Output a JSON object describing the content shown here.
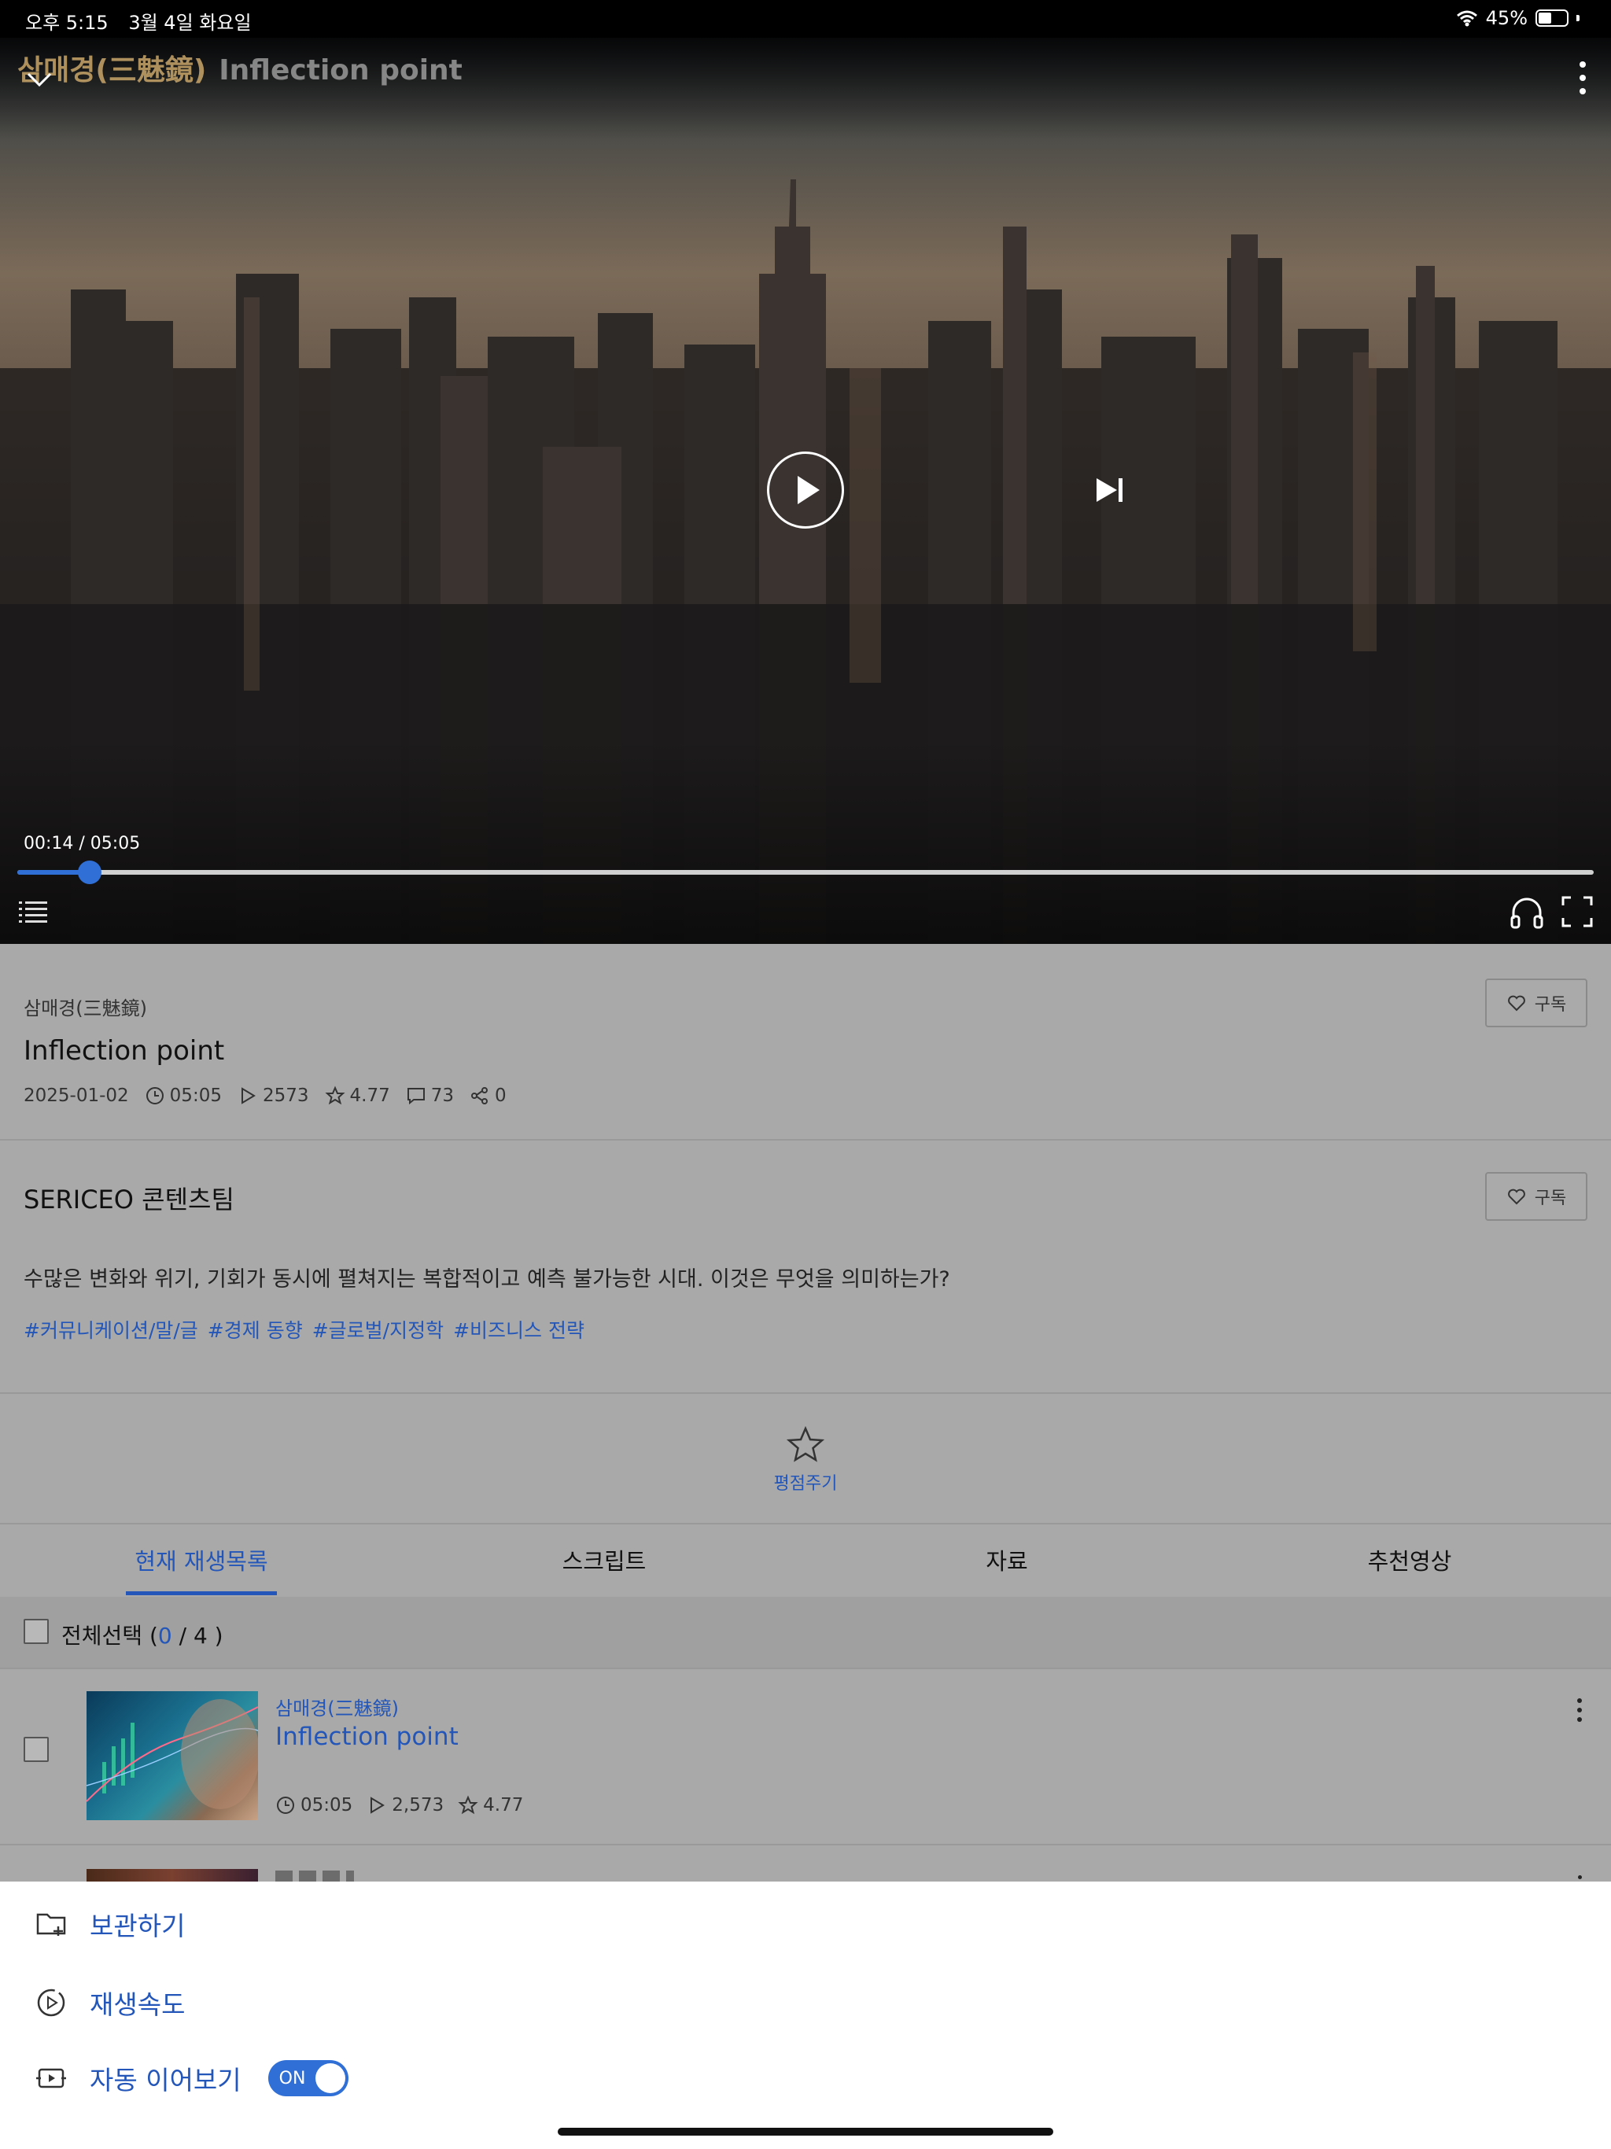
{
  "status_bar": {
    "time": "오후 5:15",
    "date": "3월 4일 화요일",
    "battery": "45%"
  },
  "player": {
    "title_ko": "삼매경(三魅鏡)",
    "title_en": "Inflection point",
    "time_display": "00:14 / 05:05",
    "progress_fraction": 0.046
  },
  "info": {
    "category": "삼매경(三魅鏡)",
    "title": "Inflection point",
    "subscribe_label": "구독",
    "date": "2025-01-02",
    "duration": "05:05",
    "plays": "2573",
    "rating": "4.77",
    "comments": "73",
    "shares": "0"
  },
  "author": {
    "name": "SERICEO 콘텐츠팀",
    "subscribe_label": "구독"
  },
  "description": "수많은 변화와 위기, 기회가 동시에 펼쳐지는 복합적이고 예측 불가능한 시대. 이것은 무엇을 의미하는가?",
  "tags": [
    "#커뮤니케이션/말/글",
    "#경제 동향",
    "#글로벌/지정학",
    "#비즈니스 전략"
  ],
  "rate": {
    "label": "평점주기"
  },
  "tabs": [
    {
      "label": "현재 재생목록",
      "active": true
    },
    {
      "label": "스크립트",
      "active": false
    },
    {
      "label": "자료",
      "active": false
    },
    {
      "label": "추천영상",
      "active": false
    }
  ],
  "playlist": {
    "select_all_label": "전체선택 (",
    "selected": "0",
    "total_suffix": " / 4 )",
    "items": [
      {
        "category": "삼매경(三魅鏡)",
        "title": "Inflection point",
        "duration": "05:05",
        "plays": "2,573",
        "rating": "4.77"
      }
    ]
  },
  "sheet": {
    "archive_label": "보관하기",
    "speed_label": "재생속도",
    "autoplay_label": "자동 이어보기",
    "autoplay_toggle": "ON"
  },
  "colors": {
    "accent": "#2356b8",
    "progress": "#2f6fd6",
    "dim_overlay": "#a9a9a9"
  }
}
